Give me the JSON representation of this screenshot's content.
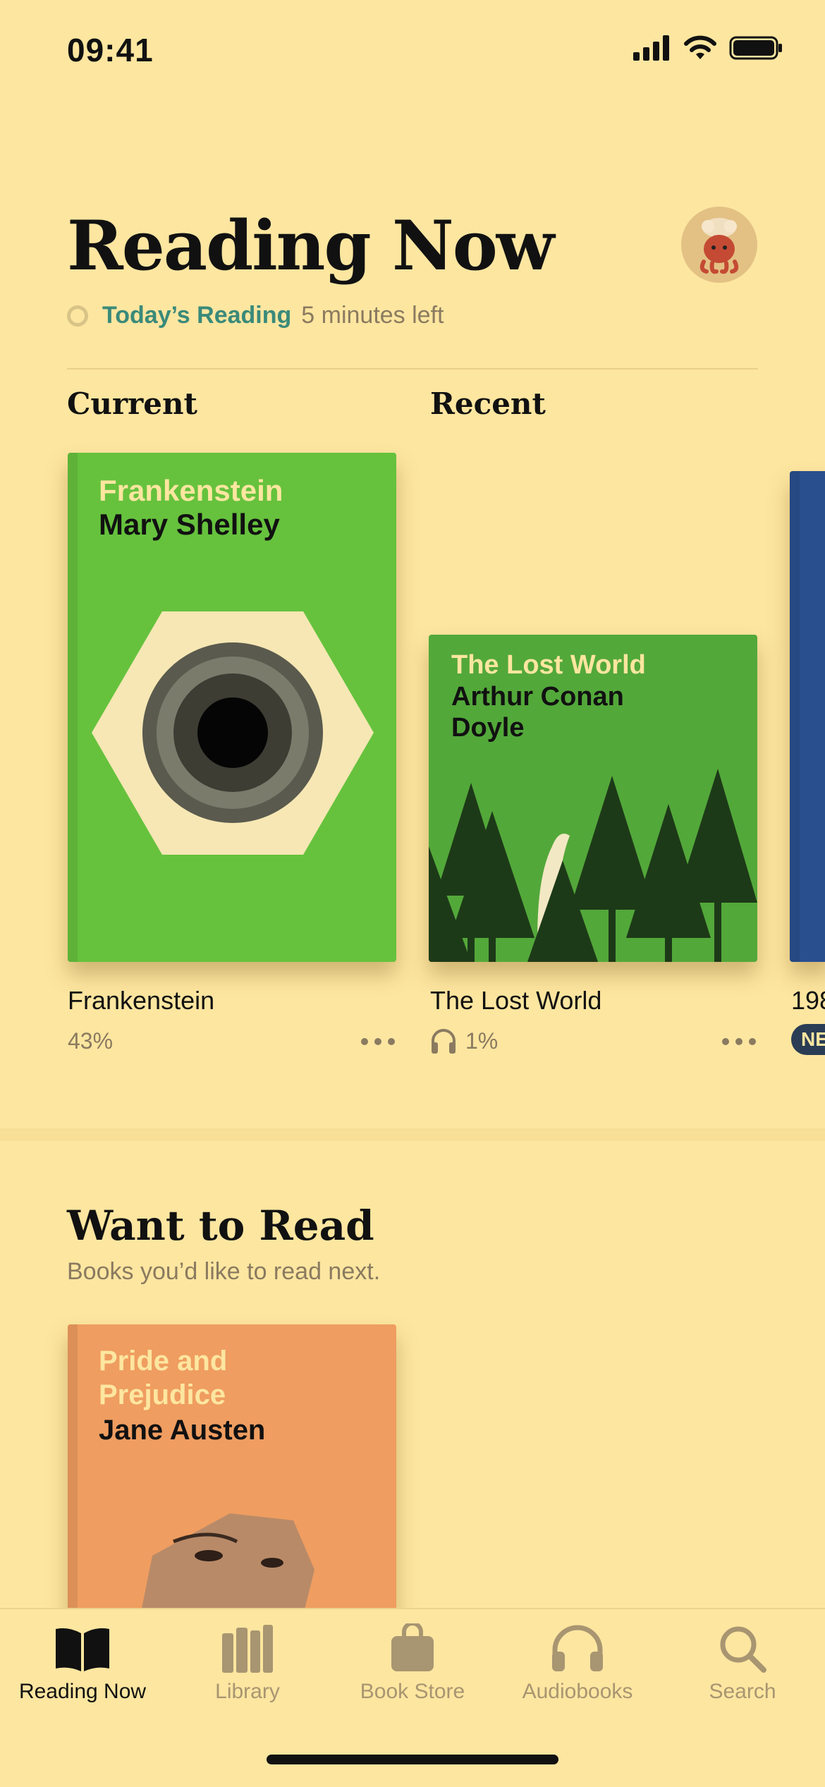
{
  "status_bar": {
    "time": "09:41",
    "battery_level": 1.0
  },
  "header": {
    "title": "Reading Now",
    "goal_link": "Today’s Reading",
    "goal_remaining": "5 minutes left"
  },
  "sections": {
    "current": "Current",
    "recent": "Recent"
  },
  "books": [
    {
      "title": "Frankenstein",
      "cover_title": "Frankenstein",
      "cover_author": "Mary Shelley",
      "progress": "43%",
      "cover_color": "#66c23d"
    },
    {
      "title": "The Lost World",
      "cover_title": "The Lost World",
      "cover_author": "Arthur Conan Doyle",
      "progress": "1%",
      "cover_color": "#53a83a"
    },
    {
      "title": "198",
      "badge": "NE",
      "cover_color": "#2a4f8f"
    }
  ],
  "want_to_read": {
    "title": "Want to Read",
    "subtitle": "Books you’d like to read next.",
    "books": [
      {
        "cover_title": "Pride and Prejudice",
        "cover_author": "Jane Austen",
        "cover_color": "#ef9d60"
      }
    ]
  },
  "tabs": [
    {
      "label": "Reading Now",
      "icon": "book-open-icon",
      "active": true
    },
    {
      "label": "Library",
      "icon": "books-icon",
      "active": false
    },
    {
      "label": "Book Store",
      "icon": "shopping-bag-icon",
      "active": false
    },
    {
      "label": "Audiobooks",
      "icon": "headphones-icon",
      "active": false
    },
    {
      "label": "Search",
      "icon": "search-icon",
      "active": false
    }
  ]
}
